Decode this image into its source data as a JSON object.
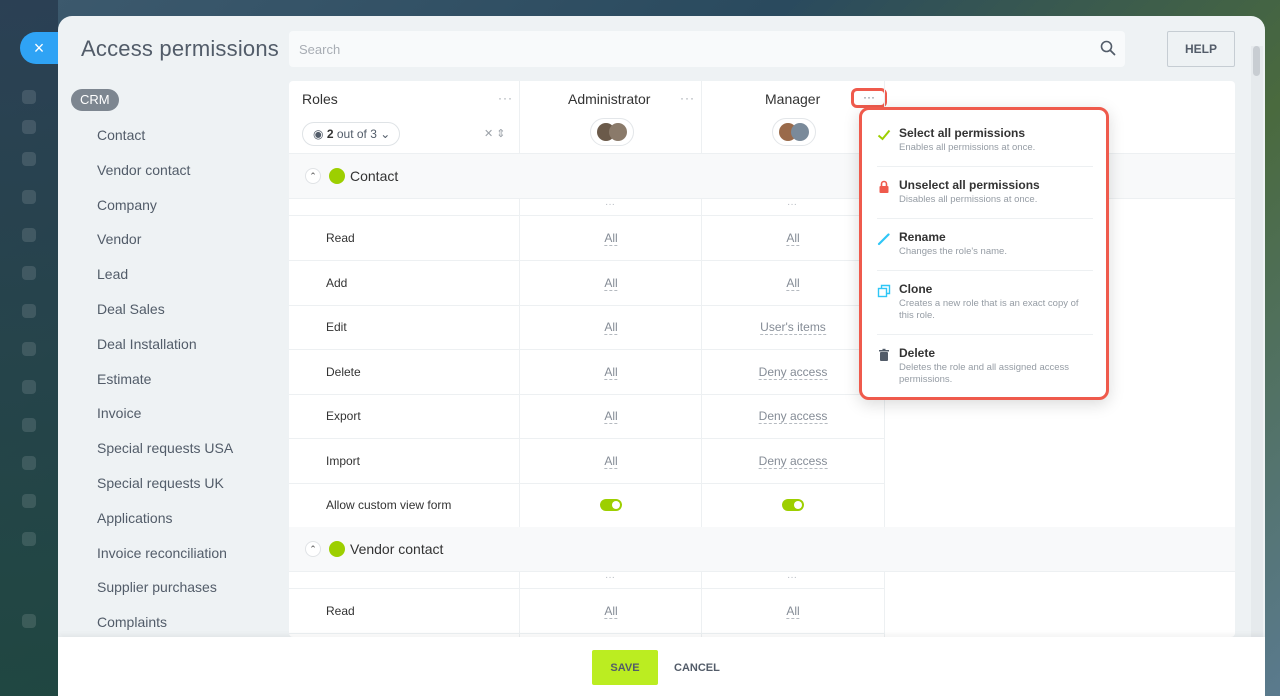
{
  "page": {
    "title": "Access permissions",
    "close_icon": "×"
  },
  "search": {
    "placeholder": "Search"
  },
  "help": {
    "label": "HELP"
  },
  "sidebar": {
    "badge": "CRM",
    "items": [
      "Contact",
      "Vendor contact",
      "Company",
      "Vendor",
      "Lead",
      "Deal Sales",
      "Deal Installation",
      "Estimate",
      "Invoice",
      "Special requests USA",
      "Special requests UK",
      "Applications",
      "Invoice reconciliation",
      "Supplier purchases",
      "Complaints"
    ]
  },
  "table": {
    "roles_label": "Roles",
    "dots": "···",
    "filter": {
      "count": "2",
      "suffix": "out of 3"
    },
    "roles": [
      {
        "name": "Administrator"
      },
      {
        "name": "Manager"
      }
    ],
    "sections": [
      {
        "label": "Contact",
        "rows": [
          {
            "label": "Read",
            "values": [
              "All",
              "All"
            ]
          },
          {
            "label": "Add",
            "values": [
              "All",
              "All"
            ]
          },
          {
            "label": "Edit",
            "values": [
              "All",
              "User's items"
            ]
          },
          {
            "label": "Delete",
            "values": [
              "All",
              "Deny access"
            ]
          },
          {
            "label": "Export",
            "values": [
              "All",
              "Deny access"
            ]
          },
          {
            "label": "Import",
            "values": [
              "All",
              "Deny access"
            ]
          },
          {
            "label": "Allow custom view form",
            "toggle": true
          }
        ]
      },
      {
        "label": "Vendor contact",
        "rows": [
          {
            "label": "Read",
            "values": [
              "All",
              "All"
            ]
          }
        ]
      }
    ]
  },
  "menu": {
    "items": [
      {
        "title": "Select all permissions",
        "desc": "Enables all permissions at once.",
        "icon": "check-icon"
      },
      {
        "title": "Unselect all permissions",
        "desc": "Disables all permissions at once.",
        "icon": "lock-icon"
      },
      {
        "title": "Rename",
        "desc": "Changes the role's name.",
        "icon": "pencil-icon"
      },
      {
        "title": "Clone",
        "desc": "Creates a new role that is an exact copy of this role.",
        "icon": "copy-icon"
      },
      {
        "title": "Delete",
        "desc": "Deletes the role and all assigned access permissions.",
        "icon": "trash-icon"
      }
    ]
  },
  "footer": {
    "save": "SAVE",
    "cancel": "CANCEL"
  },
  "colors": {
    "accent": "#9dcf00",
    "save": "#bbed21",
    "highlight": "#ef5a4c",
    "close": "#2fa3f5"
  }
}
